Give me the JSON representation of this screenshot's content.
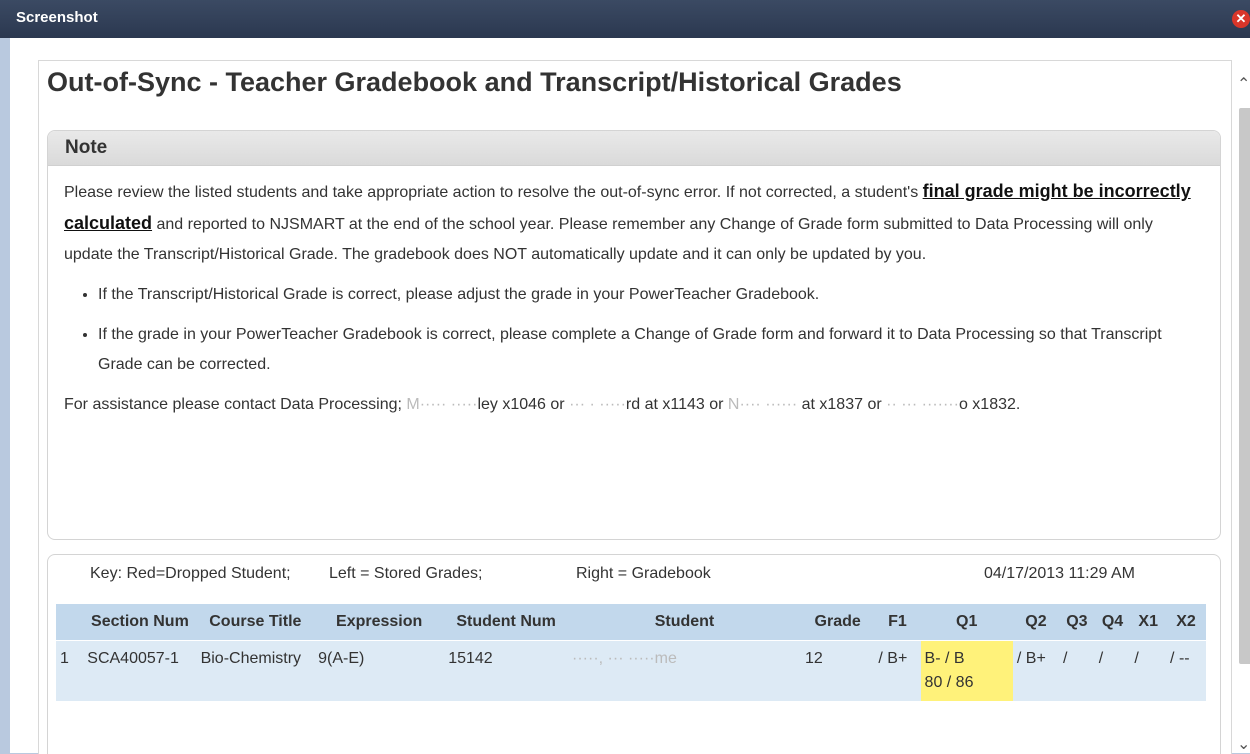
{
  "window": {
    "title": "Screenshot",
    "close_glyph": "✕"
  },
  "page": {
    "heading": "Out-of-Sync - Teacher Gradebook and Transcript/Historical Grades"
  },
  "note": {
    "header": "Note",
    "p1_before": "Please review the listed students and take appropriate action to resolve the out-of-sync error. If not corrected, a student's ",
    "p1_emphasis": "final grade might be incorrectly calculated",
    "p1_after": " and reported to NJSMART at the end of the school year. Please remember any Change of Grade form submitted to Data Processing will only update the Transcript/Historical Grade. The gradebook does NOT automatically update and it can only be updated by you.",
    "bullets": [
      "If the Transcript/Historical Grade is correct, please adjust the grade in your PowerTeacher Gradebook.",
      "If the grade in your PowerTeacher Gradebook is correct, please complete a Change of Grade form and forward it to Data Processing so that Transcript Grade can be corrected."
    ],
    "contact_1": "For assistance please contact Data Processing; ",
    "contact_r1": "M·····  ·····",
    "contact_2": "ley x1046 or ",
    "contact_r2": "··· ·  ·····",
    "contact_3": "rd at x1143 or ",
    "contact_r3": "N···· ······",
    "contact_4": " at x1837 or ",
    "contact_r4": "·· ··· ·······",
    "contact_5": "o x1832."
  },
  "key": {
    "dropped": "Key: Red=Dropped Student;",
    "left": "Left = Stored Grades;",
    "right": "Right = Gradebook",
    "timestamp": "04/17/2013 11:29 AM"
  },
  "table": {
    "headers": [
      "",
      "Section Num",
      "Course Title",
      "Expression",
      "Student Num",
      "Student",
      "Grade",
      "F1",
      "Q1",
      "Q2",
      "Q3",
      "Q4",
      "X1",
      "X2"
    ],
    "rows": [
      {
        "idx": "1",
        "section": "SCA40057-1",
        "course": "Bio-Chemistry",
        "expression": "9(A-E)",
        "student_num": "15142",
        "student": "·····, ··· ·····me",
        "grade": "12",
        "f1": "/ B+",
        "q1_a": "B- / B",
        "q1_b": "80 / 86",
        "q2": "/ B+",
        "q3": "/",
        "q4": "/",
        "x1": "/",
        "x2": "/ --"
      }
    ]
  },
  "colors": {
    "highlight": "#fff27a",
    "header_bg": "#c2d8ec",
    "row_bg": "#ddeaf5"
  }
}
